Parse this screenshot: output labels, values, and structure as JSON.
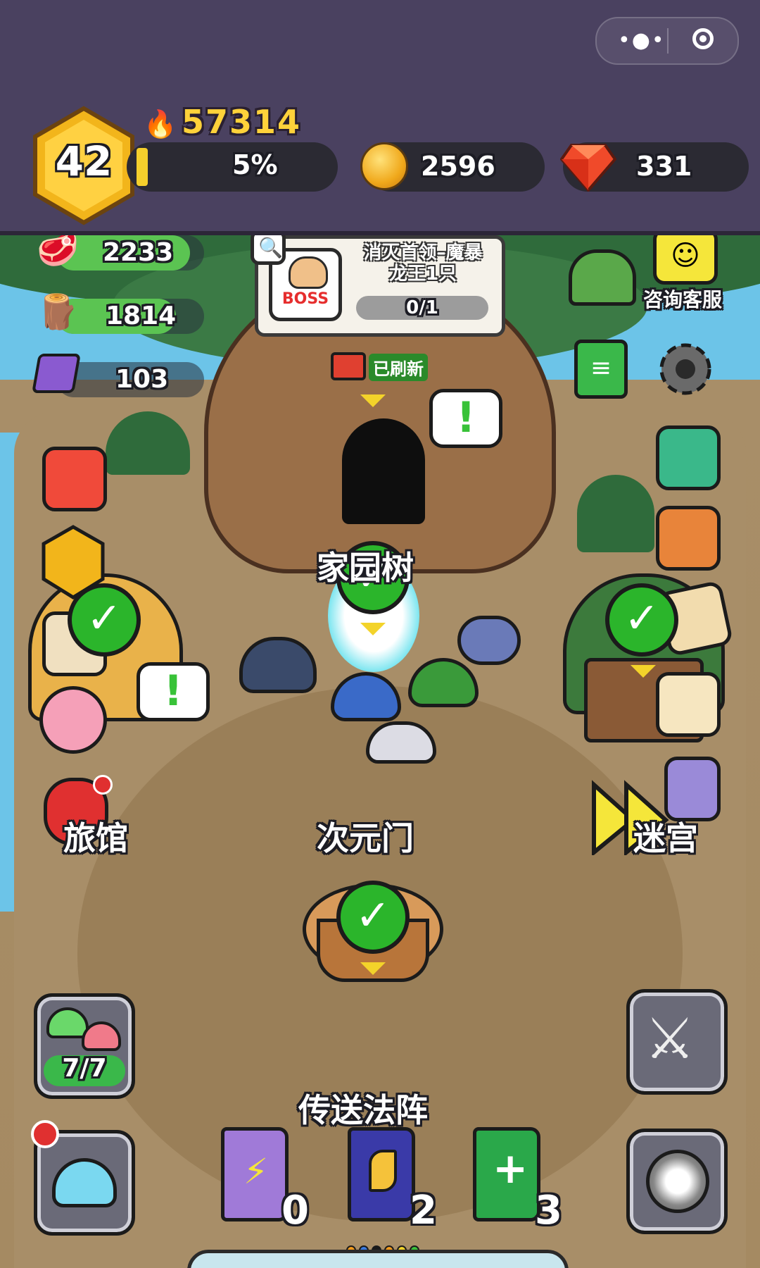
{
  "capsule": {
    "menu_icon": "more-dots-icon",
    "close_icon": "target-icon"
  },
  "player": {
    "level": "42",
    "power": "57314",
    "xp_percent": "5%",
    "xp_fraction": 0.05,
    "gold": "2596",
    "gems": "331"
  },
  "resources": [
    {
      "name": "meat",
      "icon": "meat-icon",
      "value": "2233",
      "fill": 1.0
    },
    {
      "name": "wood",
      "icon": "wood-icon",
      "value": "1814",
      "fill": 0.84
    },
    {
      "name": "crystal",
      "icon": "crystal-icon",
      "value": "103",
      "fill": 0.0
    }
  ],
  "boss_quest": {
    "badge": "BOSS",
    "title_line1": "消灭首领–魔暴",
    "title_line2": "龙王1只",
    "progress": "0/1"
  },
  "refreshed_label": "已刷新",
  "support_label": "咨询客服",
  "locations": {
    "tree": "家园树",
    "portal": "次元门",
    "inn": "旅馆",
    "maze": "迷宫",
    "teleport": "传送法阵"
  },
  "slime_count": "7/7",
  "books": [
    {
      "name": "lightning-book",
      "count": "0",
      "color": "#a07ad8"
    },
    {
      "name": "wing-book",
      "count": "2",
      "color": "#3a3aa8"
    },
    {
      "name": "heal-book",
      "count": "3",
      "color": "#2aa84a"
    }
  ],
  "pager_colors": [
    "#f39a1b",
    "#3a7ae0",
    "#1b1b1b",
    "#f39a1b",
    "#f3d32a",
    "#3ac23a"
  ],
  "colors": {
    "header_bg": "#4a4160",
    "level_gold": "#f2b51b",
    "check_green": "#2bb52b",
    "power_yellow": "#ffd23a"
  }
}
